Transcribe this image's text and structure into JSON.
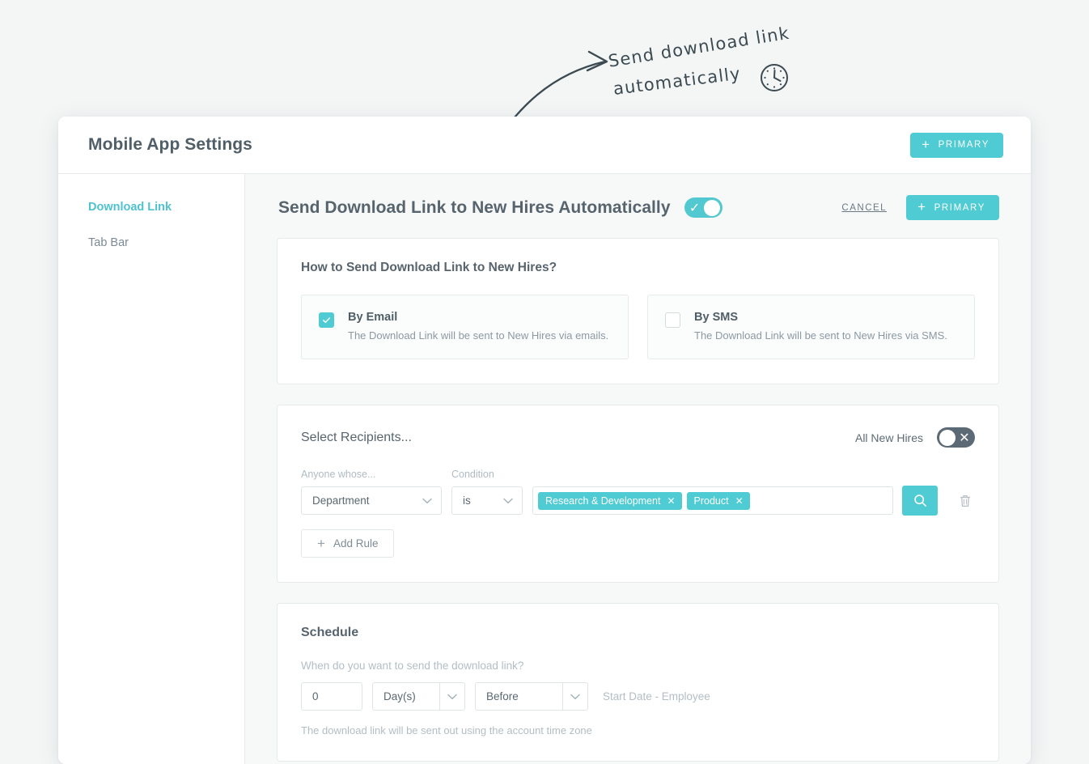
{
  "annotation": {
    "line1": "Send  download link",
    "line2": "automatically",
    "clock_icon": "clock-icon",
    "arrow_icon": "curved-arrow-icon"
  },
  "header": {
    "title": "Mobile App Settings",
    "primary_button": "PRIMARY",
    "plus": "+"
  },
  "sidebar": {
    "items": [
      {
        "label": "Download Link",
        "active": true
      },
      {
        "label": "Tab Bar",
        "active": false
      }
    ]
  },
  "content_header": {
    "title": "Send Download Link to New Hires Automatically",
    "master_toggle": {
      "state": "on",
      "glyph": "✓"
    },
    "cancel_label": "CANCEL",
    "primary_button": "PRIMARY",
    "plus": "+"
  },
  "how_to_send": {
    "title": "How to Send Download Link to New Hires?",
    "options": [
      {
        "name": "By Email",
        "description": "The Download Link will be sent to New Hires via emails.",
        "checked": true,
        "check_glyph": "✓"
      },
      {
        "name": "By SMS",
        "description": "The Download Link will be sent to New Hires via SMS.",
        "checked": false,
        "check_glyph": ""
      }
    ]
  },
  "recipients": {
    "title": "Select Recipients...",
    "all_new_hires_label": "All New Hires",
    "all_new_hires_toggle": {
      "state": "off",
      "glyph": "✕"
    },
    "labels": {
      "attribute": "Anyone whose...",
      "condition": "Condition"
    },
    "rule": {
      "attribute_value": "Department",
      "condition_value": "is",
      "tags": [
        {
          "label": "Research & Development",
          "remove": "✕"
        },
        {
          "label": "Product",
          "remove": "✕"
        }
      ],
      "search_icon": "search-icon",
      "delete_icon": "trash-icon"
    },
    "add_rule_label": "Add Rule",
    "add_rule_plus": "+"
  },
  "schedule": {
    "title": "Schedule",
    "question": "When do you want to send the download link?",
    "amount_value": "0",
    "unit_value": "Day(s)",
    "relation_value": "Before",
    "reference": "Start Date - Employee",
    "note": "The download link will be sent out using the account time zone",
    "chevron": "⌄"
  },
  "colors": {
    "accent": "#4ecbd3",
    "toggle_off": "#5b6a75",
    "text_dark": "#57646e",
    "text_muted": "#b3bec4",
    "page_bg": "#f4f6f6",
    "content_bg": "#f7f8f8"
  }
}
